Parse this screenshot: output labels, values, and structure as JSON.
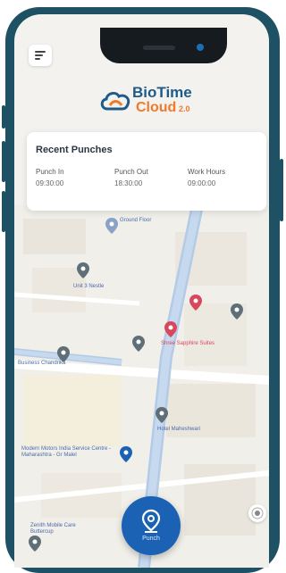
{
  "brand": {
    "name_part1": "BioTime",
    "name_part2": "Cloud",
    "version": "2.0"
  },
  "recent_punches": {
    "title": "Recent Punches",
    "columns": [
      {
        "label": "Punch In",
        "value": "09:30:00"
      },
      {
        "label": "Punch Out",
        "value": "18:30:00"
      },
      {
        "label": "Work Hours",
        "value": "09:00:00"
      }
    ]
  },
  "map": {
    "labels": [
      "Ground Floor",
      "Unit 3 Nestle",
      "Shree Sapphire Suites",
      "Hotel Maheshwari",
      "Modern Motors India Service Centre - Maharashtra - Gr Malel",
      "Business Chandrika",
      "Zenith Mobile Care Buttercup"
    ]
  },
  "actions": {
    "punch_label": "Punch"
  },
  "colors": {
    "frame": "#1f5164",
    "accent": "#1b62b4",
    "brand_orange": "#f07a2a",
    "brand_blue": "#1f5b8a"
  },
  "icons": [
    "menu-icon",
    "cloud-logo-icon",
    "map-pin-icon",
    "punch-location-icon",
    "locate-icon"
  ]
}
